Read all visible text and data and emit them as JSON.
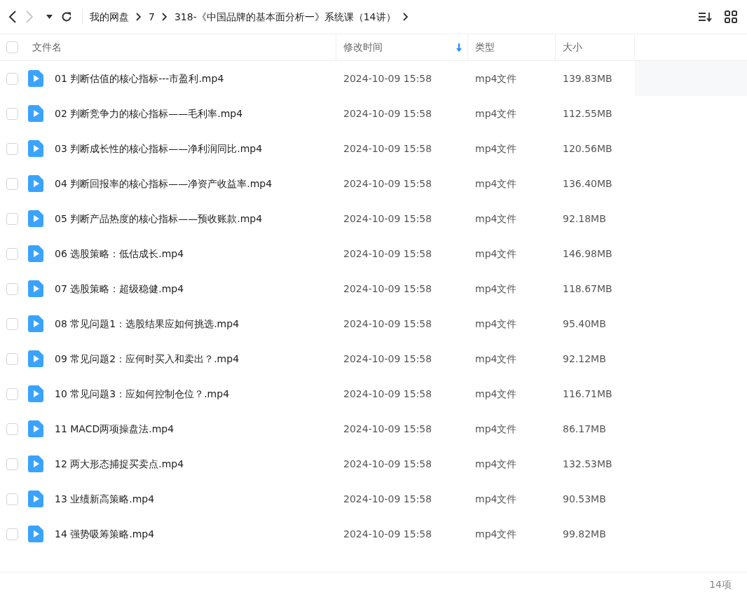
{
  "toolbar": {
    "nav": [
      {
        "kind": "back",
        "disabled": false
      },
      {
        "kind": "forward",
        "disabled": true
      },
      {
        "kind": "history",
        "disabled": false
      },
      {
        "kind": "refresh",
        "disabled": false
      }
    ],
    "breadcrumb": [
      "我的网盘",
      "7",
      "318-《中国品牌的基本面分析一》系统课（14讲）"
    ]
  },
  "table": {
    "select_all_checked": false,
    "columns": [
      {
        "label": "文件名",
        "sorted": false
      },
      {
        "label": "修改时间",
        "sorted": true
      },
      {
        "label": "类型",
        "sorted": false
      },
      {
        "label": "大小",
        "sorted": false
      }
    ],
    "rows": [
      {
        "name": "01 判断估值的核心指标---市盈利.mp4",
        "modified": "2024-10-09 15:58",
        "type": "mp4文件",
        "size": "139.83MB",
        "checked": false,
        "hovered": true
      },
      {
        "name": "02 判断竞争力的核心指标——毛利率.mp4",
        "modified": "2024-10-09 15:58",
        "type": "mp4文件",
        "size": "112.55MB",
        "checked": false,
        "hovered": false
      },
      {
        "name": "03 判断成长性的核心指标——净利润同比.mp4",
        "modified": "2024-10-09 15:58",
        "type": "mp4文件",
        "size": "120.56MB",
        "checked": false,
        "hovered": false
      },
      {
        "name": "04 判断回报率的核心指标——净资产收益率.mp4",
        "modified": "2024-10-09 15:58",
        "type": "mp4文件",
        "size": "136.40MB",
        "checked": false,
        "hovered": false
      },
      {
        "name": "05 判断产品热度的核心指标——预收账款.mp4",
        "modified": "2024-10-09 15:58",
        "type": "mp4文件",
        "size": "92.18MB",
        "checked": false,
        "hovered": false
      },
      {
        "name": "06 选股策略：低估成长.mp4",
        "modified": "2024-10-09 15:58",
        "type": "mp4文件",
        "size": "146.98MB",
        "checked": false,
        "hovered": false
      },
      {
        "name": "07 选股策略：超级稳健.mp4",
        "modified": "2024-10-09 15:58",
        "type": "mp4文件",
        "size": "118.67MB",
        "checked": false,
        "hovered": false
      },
      {
        "name": "08 常见问题1：选股结果应如何挑选.mp4",
        "modified": "2024-10-09 15:58",
        "type": "mp4文件",
        "size": "95.40MB",
        "checked": false,
        "hovered": false
      },
      {
        "name": "09 常见问题2：应何时买入和卖出？.mp4",
        "modified": "2024-10-09 15:58",
        "type": "mp4文件",
        "size": "92.12MB",
        "checked": false,
        "hovered": false
      },
      {
        "name": "10 常见问题3：应如何控制仓位？.mp4",
        "modified": "2024-10-09 15:58",
        "type": "mp4文件",
        "size": "116.71MB",
        "checked": false,
        "hovered": false
      },
      {
        "name": "11 MACD两项操盘法.mp4",
        "modified": "2024-10-09 15:58",
        "type": "mp4文件",
        "size": "86.17MB",
        "checked": false,
        "hovered": false
      },
      {
        "name": "12 两大形态捕捉买卖点.mp4",
        "modified": "2024-10-09 15:58",
        "type": "mp4文件",
        "size": "132.53MB",
        "checked": false,
        "hovered": false
      },
      {
        "name": "13 业绩新高策略.mp4",
        "modified": "2024-10-09 15:58",
        "type": "mp4文件",
        "size": "90.53MB",
        "checked": false,
        "hovered": false
      },
      {
        "name": "14 强势吸筹策略.mp4",
        "modified": "2024-10-09 15:58",
        "type": "mp4文件",
        "size": "99.82MB",
        "checked": false,
        "hovered": false
      }
    ]
  },
  "status_bar": {
    "count": "14项"
  }
}
